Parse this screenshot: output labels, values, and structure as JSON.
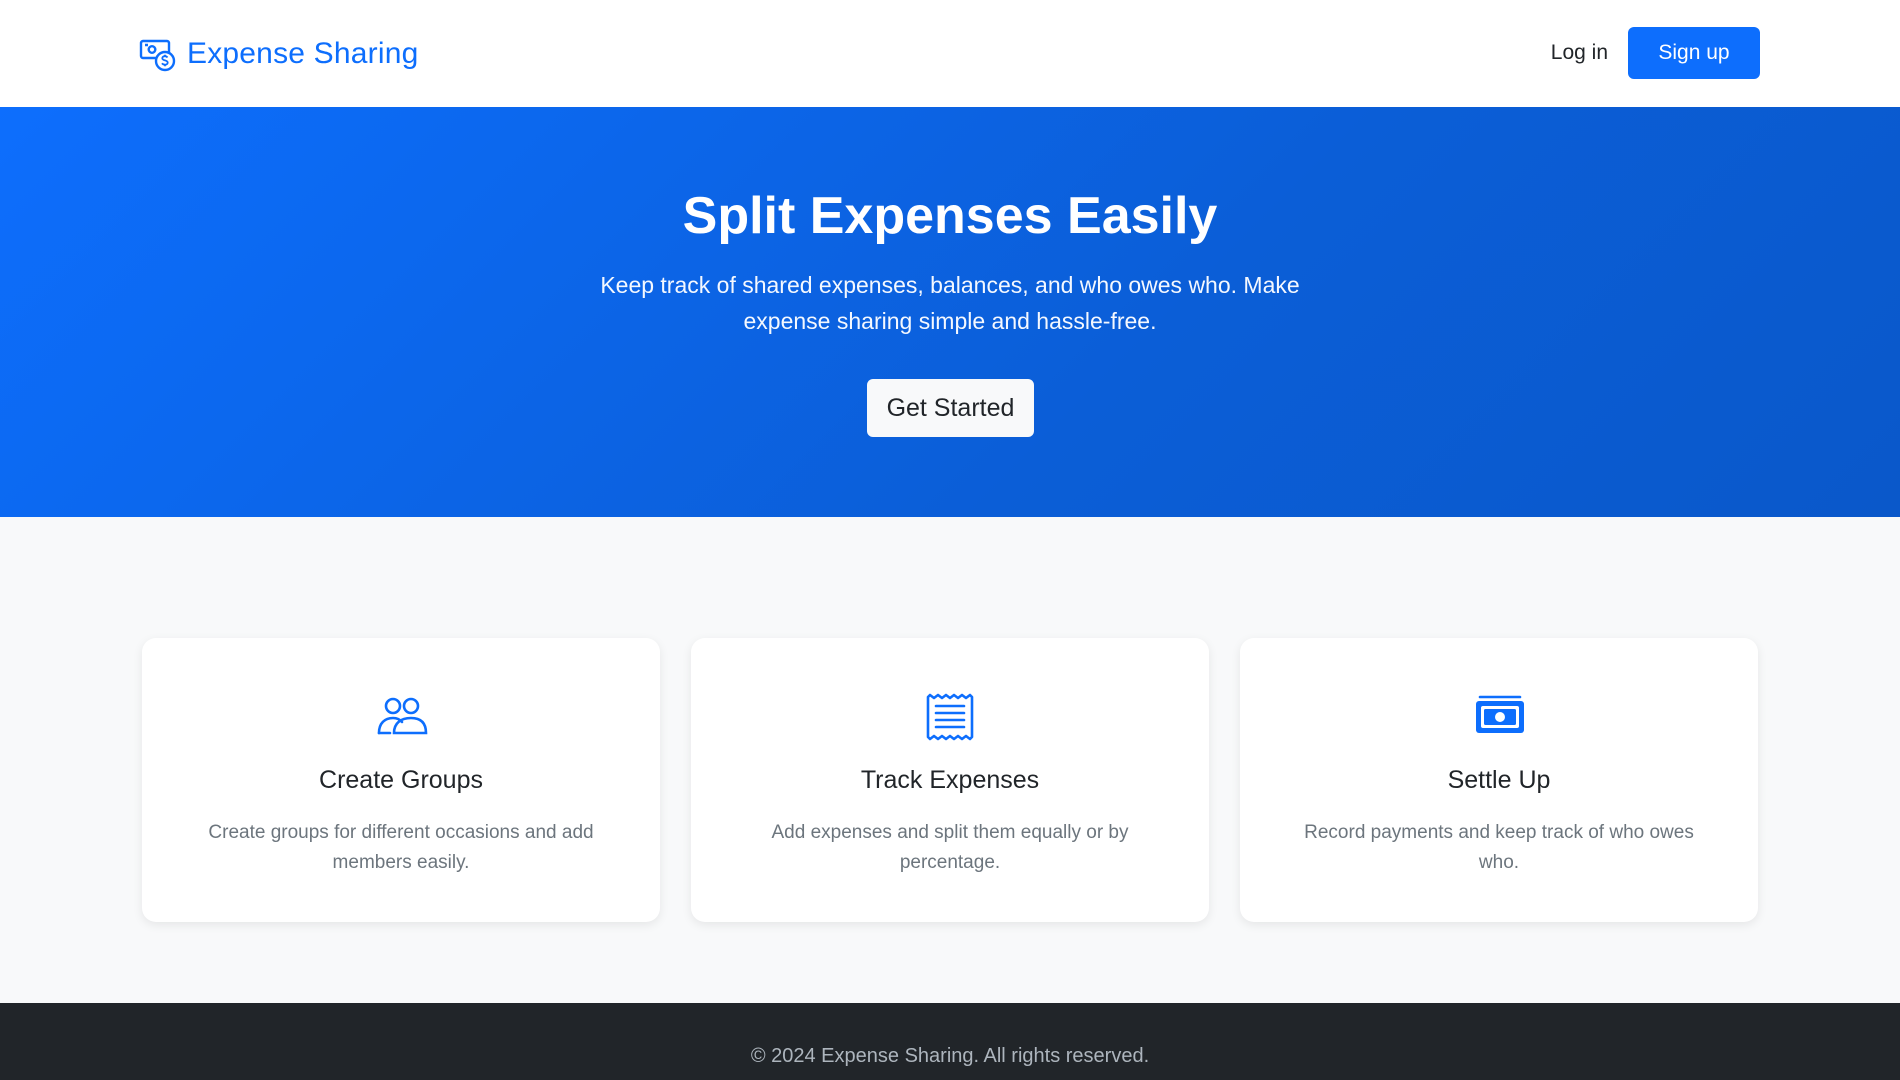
{
  "navbar": {
    "brand_name": "Expense Sharing",
    "brand_icon": "cash-coin-icon",
    "login_label": "Log in",
    "signup_label": "Sign up",
    "accent_color": "#0d6efd"
  },
  "hero": {
    "title": "Split Expenses Easily",
    "subtitle": "Keep track of shared expenses, balances, and who owes who. Make expense sharing simple and hassle-free.",
    "cta_label": "Get Started"
  },
  "features": [
    {
      "icon": "people-icon",
      "title": "Create Groups",
      "description": "Create groups for different occasions and add members easily."
    },
    {
      "icon": "receipt-icon",
      "title": "Track Expenses",
      "description": "Add expenses and split them equally or by percentage."
    },
    {
      "icon": "cash-icon",
      "title": "Settle Up",
      "description": "Record payments and keep track of who owes who."
    }
  ],
  "footer": {
    "copyright": "© 2024 Expense Sharing. All rights reserved."
  }
}
